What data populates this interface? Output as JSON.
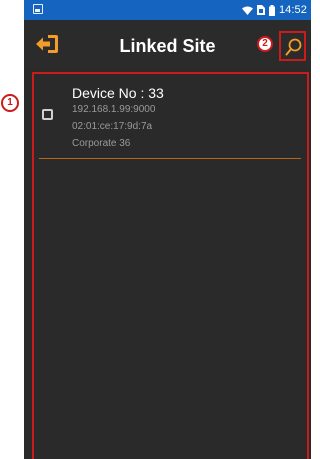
{
  "status_bar": {
    "time": "14:52",
    "icons": [
      "image-icon",
      "wifi-icon",
      "sim-icon",
      "battery-icon"
    ]
  },
  "app_bar": {
    "title": "Linked Site",
    "back_icon": "back-arrow-icon",
    "search_icon": "search-icon"
  },
  "annotations": {
    "callout_1": "1",
    "callout_2": "2",
    "highlight_color": "#cc1b1b"
  },
  "devices": [
    {
      "title": "Device No : 33",
      "ip": "192.168.1.99:9000",
      "mac": "02:01:ce:17:9d:7a",
      "group": "Corporate 36",
      "checked": false
    }
  ],
  "colors": {
    "status_bar": "#1565c0",
    "background": "#2a2a2a",
    "accent": "#f39c2b",
    "divider": "#b5651d"
  }
}
